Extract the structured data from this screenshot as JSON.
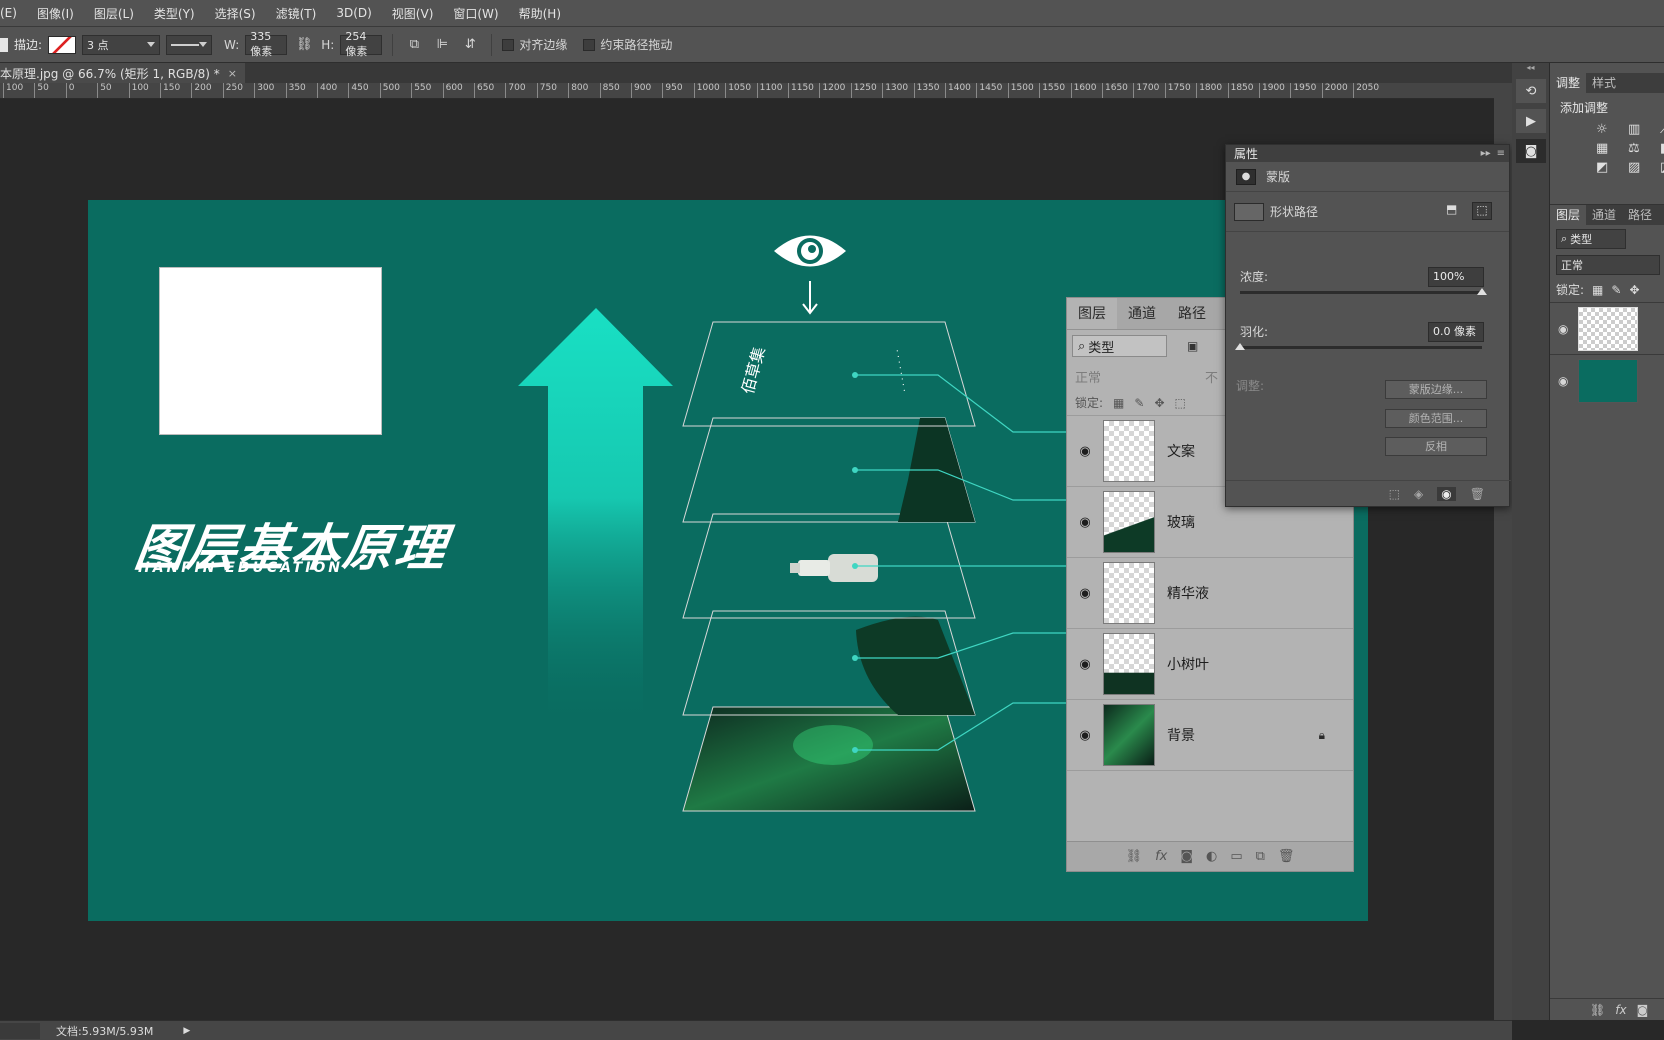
{
  "menu": [
    "(E)",
    "图像(I)",
    "图层(L)",
    "类型(Y)",
    "选择(S)",
    "滤镜(T)",
    "3D(D)",
    "视图(V)",
    "窗口(W)",
    "帮助(H)"
  ],
  "options": {
    "stroke_label": "描边:",
    "stroke_size": "3 点",
    "w_label": "W:",
    "w_value": "335 像素",
    "h_label": "H:",
    "h_value": "254 像素",
    "align_edges": "对齐边缘",
    "constrain_path": "约束路径拖动"
  },
  "doc_tab": {
    "title": "本原理.jpg @ 66.7% (矩形 1, RGB/8) *",
    "close": "×"
  },
  "ruler_ticks": [
    "100",
    "50",
    "0",
    "50",
    "100",
    "150",
    "200",
    "250",
    "300",
    "350",
    "400",
    "450",
    "500",
    "550",
    "600",
    "650",
    "700",
    "750",
    "800",
    "850",
    "900",
    "950",
    "1000",
    "1050",
    "1100",
    "1150",
    "1200",
    "1250",
    "1300",
    "1350",
    "1400",
    "1450",
    "1500",
    "1550",
    "1600",
    "1650",
    "1700",
    "1750",
    "1800",
    "1850",
    "1900",
    "1950",
    "2000",
    "2050"
  ],
  "canvas": {
    "title": "图层基本原理",
    "subtitle": "HANPIN EDUCATION",
    "colors": {
      "bg": "#0a6c60",
      "arrow": "#19e0c4",
      "line": "#3fd6c2"
    },
    "layers_panel": {
      "tabs": [
        "图层",
        "通道",
        "路径"
      ],
      "filter_label": "类型",
      "blend_mode": "正常",
      "opacity_abbr": "不",
      "lock_label": "锁定:",
      "layers": [
        {
          "name": "文案",
          "locked": false
        },
        {
          "name": "玻璃",
          "locked": false
        },
        {
          "name": "精华液",
          "locked": false
        },
        {
          "name": "小树叶",
          "locked": false
        },
        {
          "name": "背景",
          "locked": true
        }
      ]
    },
    "card_text": "佰草集"
  },
  "properties": {
    "title": "属性",
    "mask_label": "蒙版",
    "shape_path_label": "形状路径",
    "density_label": "浓度:",
    "density_value": "100%",
    "density_level": 1.0,
    "feather_label": "羽化:",
    "feather_value": "0.0 像素",
    "feather_level": 0.0,
    "adjust_label": "调整:",
    "buttons": [
      "蒙版边缘...",
      "颜色范围...",
      "反相"
    ]
  },
  "adjust_panel": {
    "tabs": [
      "调整",
      "样式"
    ],
    "add_label": "添加调整"
  },
  "right_layers": {
    "tabs": [
      "图层",
      "通道",
      "路径"
    ],
    "filter_label": "类型",
    "blend_mode": "正常",
    "lock_label": "锁定:"
  },
  "status": {
    "doc": "文档:5.93M/5.93M"
  }
}
